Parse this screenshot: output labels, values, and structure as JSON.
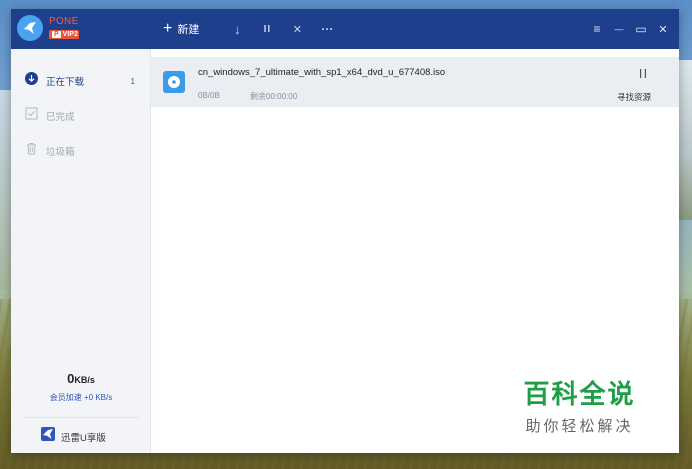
{
  "brand": {
    "name": "PONE",
    "vip_prefix": "P",
    "vip_text": "VIP2"
  },
  "toolbar": {
    "new_label": "新建",
    "plus_glyph": "+",
    "download_glyph": "↓",
    "pause_glyph": "II",
    "delete_glyph": "✕",
    "more_glyph": "···"
  },
  "window_controls": {
    "menu_glyph": "≡",
    "minimize_glyph": "—",
    "maximize_glyph": "▭",
    "close_glyph": "✕"
  },
  "sidebar": {
    "items": [
      {
        "label": "正在下载",
        "count": "1",
        "icon": "download-circle-icon",
        "active": true
      },
      {
        "label": "已完成",
        "icon": "check-box-icon",
        "active": false
      },
      {
        "label": "垃圾箱",
        "icon": "trash-icon",
        "active": false
      }
    ],
    "speed_value": "0",
    "speed_unit": "KB/s",
    "vip_speed": "会员加速 +0 KB/s",
    "udisk_label": "迅雷U享版"
  },
  "downloads": [
    {
      "filename": "cn_windows_7_ultimate_with_sp1_x64_dvd_u_677408.iso",
      "progress": "0B/0B",
      "remaining": "剩余00:00:00",
      "action": "寻找资源"
    }
  ],
  "watermark": {
    "title": "百科全说",
    "subtitle": "助你轻松解决"
  },
  "colors": {
    "titlebar": "#1d3f8c",
    "accent": "#2d57b8",
    "row_bg": "#eaedf2",
    "watermark_green": "#1f9d47"
  }
}
